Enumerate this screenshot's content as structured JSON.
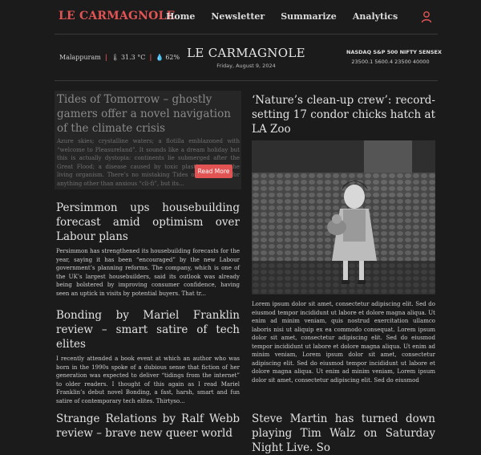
{
  "header": {
    "brand": "LE CARMAGNOLE",
    "nav": [
      "Home",
      "Newsletter",
      "Summarize",
      "Analytics"
    ]
  },
  "infobar": {
    "location": "Malappuram",
    "temperature": "31.3 °C",
    "humidity": "62%",
    "title": "LE CARMAGNOLE",
    "date": "Friday, August 9, 2024",
    "markets_names": "NASDAQ S&P 500 NIFTY SENSEX",
    "markets_values": "23500.1   5600.4   23500   40000"
  },
  "featured": {
    "title": "Tides of Tomorrow – ghostly gamers offer a novel navigation of the climate crisis",
    "excerpt": "Azure skies; crystalline waters; a flotilla emblazoned with “welcome to Pleasureland”. It sounds like a dream holiday but this is actually dystopia: continents lie submerged after the Great Flood; a disease caused by toxic plastic ravages the living organism. There’s no mistaking Tides of Tomorrow for anything other than anxious “cli-fi”, but its...",
    "read_more": "Read More"
  },
  "articles": [
    {
      "title": "Persimmon ups housebuilding forecast amid optimism over Labour plans",
      "excerpt": "Persimmon has strengthened its housebuilding forecasts for the year, saying it has been “encouraged” by the new Labour government’s planning reforms. The company, which is one of the UK’s largest housebuilders, said its outlook was already being bolstered by improving consumer confidence, having seen an uptick in visits by potential buyers. That tr..."
    },
    {
      "title": "Bonding by Mariel Franklin review – smart satire of tech elites",
      "excerpt": "I recently attended a book event at which an author who was born in the 1990s spoke of a dubious sense that fiction of her generation was expected to deliver “tidings from the internet” to older readers. I thought of this again as I read Mariel Franklin’s debut novel Bonding, a fast, harsh, smart and fun satire of contemporary tech elites. Thirtyso..."
    },
    {
      "title": "Strange Relations by Ralf Webb review – brave new queer world",
      "excerpt": ""
    }
  ],
  "right_articles": [
    {
      "title": "‘Nature’s clean-up crew’: record-setting 17 condor chicks hatch at LA Zoo",
      "excerpt": "Lorem ipsum dolor sit amet, consectetur adipiscing elit. Sed do eiusmod tempor incididunt ut labore et dolore magna aliqua. Ut enim ad minim veniam, quis nostrud exercitation ullamco laboris nisi ut aliquip ex ea commodo consequat. Lorem ipsum dolor sit amet, consectetur adipiscing elit. Sed do eiusmod tempor incididunt ut labore et dolore magna aliqua. Ut enim ad minim veniam, Lorem ipsum dolor sit amet, consectetur adipiscing elit. Sed do eiusmod tempor incididunt ut labore et dolore magna aliqua. Ut enim ad minim veniam, Lorem ipsum dolor sit amet, consectetur adipiscing elit. Sed do eiusmod"
    },
    {
      "title": "Steve Martin has turned down playing Tim Walz on Saturday Night Live. So",
      "excerpt": ""
    }
  ],
  "icons": {
    "user": "user-icon",
    "temperature": "thermometer-icon",
    "humidity": "humidity-icon"
  },
  "colors": {
    "accent": "#e25454",
    "background": "#1b1b1b"
  }
}
